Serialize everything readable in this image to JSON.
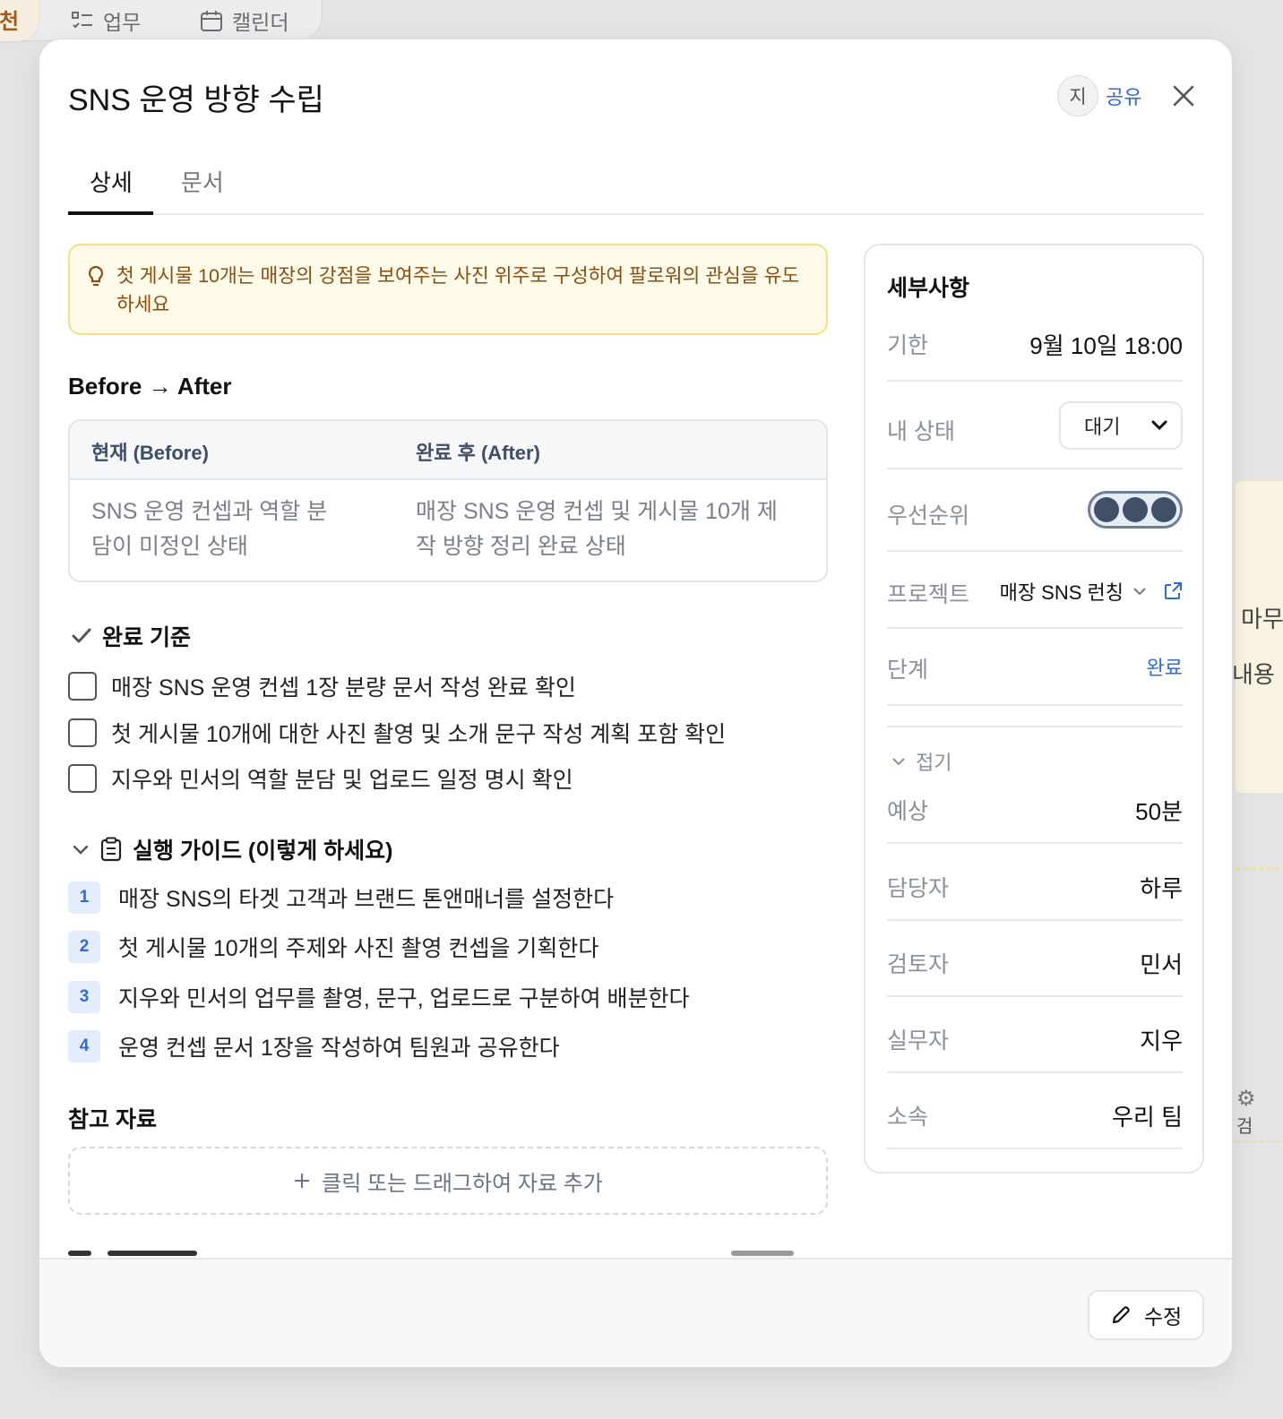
{
  "background": {
    "tab_active_label": "천",
    "tabs": [
      {
        "label": "업무",
        "icon": "task-list-icon"
      },
      {
        "label": "캘린더",
        "icon": "calendar-icon"
      }
    ],
    "card_text_1": "마무",
    "card_text_2": "내용",
    "card_text_3": "검"
  },
  "modal": {
    "title": "SNS 운영 방향 수립",
    "avatar_initial": "지",
    "share_label": "공유",
    "tabs": [
      "상세",
      "문서"
    ],
    "active_tab": "상세",
    "tip": "첫 게시물 10개는 매장의 강점을 보여주는 사진 위주로 구성하여 팔로워의 관심을 유도하세요",
    "before_after": {
      "heading": "Before → After",
      "before_header": "현재 (Before)",
      "after_header": "완료 후 (After)",
      "before_text": "SNS 운영 컨셉과 역할 분담이 미정인 상태",
      "after_text": "매장 SNS 운영 컨셉 및 게시물 10개 제작 방향 정리 완료 상태"
    },
    "criteria": {
      "heading": "완료 기준",
      "items": [
        {
          "label": "매장 SNS 운영 컨셉 1장 분량 문서 작성 완료 확인",
          "checked": false
        },
        {
          "label": "첫 게시물 10개에 대한 사진 촬영 및 소개 문구 작성 계획 포함 확인",
          "checked": false
        },
        {
          "label": "지우와 민서의 역할 분담 및 업로드 일정 명시 확인",
          "checked": false
        }
      ]
    },
    "guide": {
      "heading": "실행 가이드 (이렇게 하세요)",
      "steps": [
        {
          "num": "1",
          "text": "매장 SNS의 타겟 고객과 브랜드 톤앤매너를 설정한다"
        },
        {
          "num": "2",
          "text": "첫 게시물 10개의 주제와 사진 촬영 컨셉을 기획한다"
        },
        {
          "num": "3",
          "text": "지우와 민서의 업무를 촬영, 문구, 업로드로 구분하여 배분한다"
        },
        {
          "num": "4",
          "text": "운영 컨셉 문서 1장을 작성하여 팀원과 공유한다"
        }
      ]
    },
    "references": {
      "heading": "참고 자료",
      "add_label": "클릭 또는 드래그하여 자료 추가"
    },
    "details": {
      "heading": "세부사항",
      "deadline_label": "기한",
      "deadline_value": "9월 10일 18:00",
      "my_status_label": "내 상태",
      "my_status_value": "대기",
      "priority_label": "우선순위",
      "priority_level": 3,
      "priority_max": 3,
      "project_label": "프로젝트",
      "project_value": "매장 SNS 런칭",
      "stage_label": "단계",
      "stage_value": "완료",
      "fold_label": "접기",
      "estimate_label": "예상",
      "estimate_value": "50분",
      "assignee_label": "담당자",
      "assignee_value": "하루",
      "reviewer_label": "검토자",
      "reviewer_value": "민서",
      "worker_label": "실무자",
      "worker_value": "지우",
      "team_label": "소속",
      "team_value": "우리 팀"
    },
    "edit_label": "수정",
    "colors": {
      "accent": "#2f6ad9",
      "tip_background": "#fffbe8",
      "tip_border": "#f6df7e",
      "tip_text": "#8a4d12",
      "priority_fill": "#3f5068"
    }
  }
}
